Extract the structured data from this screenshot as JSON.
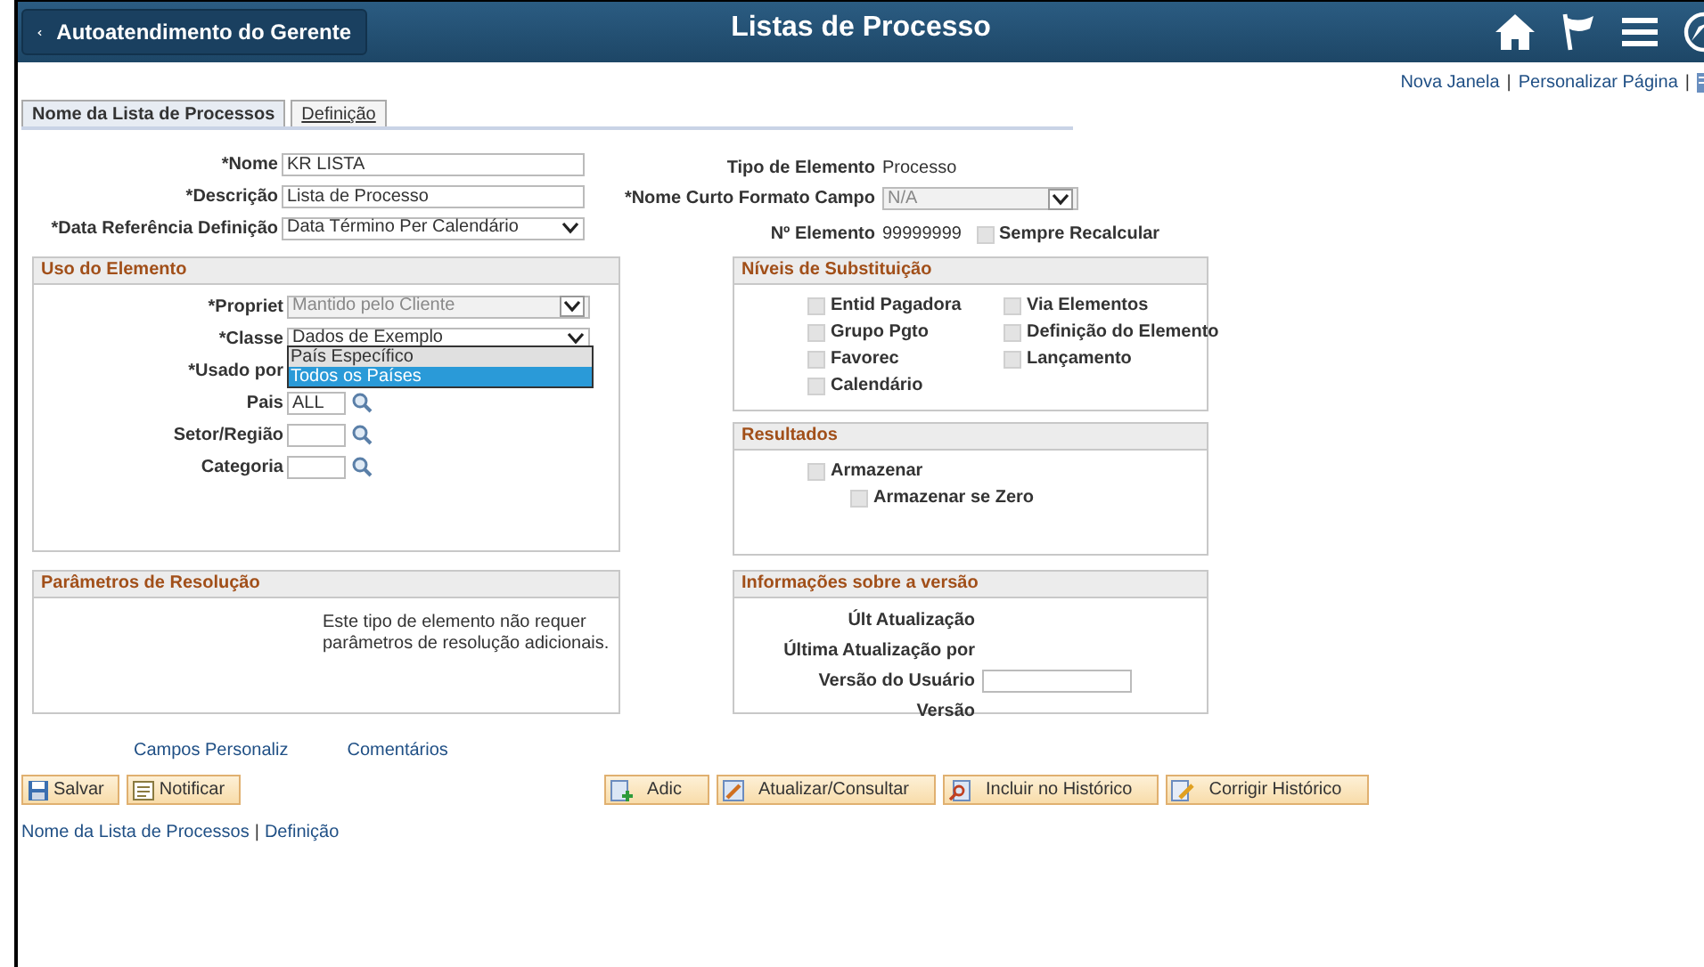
{
  "header": {
    "back_button": "Autoatendimento do Gerente",
    "title": "Listas de Processo"
  },
  "top_links": [
    {
      "kind": "link",
      "text": "Nova Janela"
    },
    {
      "kind": "separator",
      "text": "|"
    },
    {
      "kind": "link",
      "text": "Personalizar Página"
    },
    {
      "kind": "separator",
      "text": "|"
    }
  ],
  "tabs": [
    {
      "label": "Nome da Lista de Processos",
      "selected": true
    },
    {
      "label": "Definição",
      "selected": false
    }
  ],
  "fields_left": [
    {
      "label": "*Nome",
      "value": "KR LISTA",
      "kind": "text"
    },
    {
      "label": "*Descrição",
      "value": "Lista de Processo",
      "kind": "text"
    },
    {
      "label": "*Data Referência Definição",
      "value": "Data Término Per Calendário",
      "kind": "select"
    }
  ],
  "fields_right": [
    {
      "label": "Tipo de Elemento",
      "value": "Processo",
      "kind": "static"
    },
    {
      "label": "*Nome Curto Formato Campo",
      "value": "N/A",
      "kind": "select_disabled"
    },
    {
      "label": "Nº Elemento",
      "value": "99999999",
      "kind": "static",
      "checkbox": {
        "label": "Sempre Recalcular",
        "checked": false,
        "disabled": true
      }
    }
  ],
  "uso_do_elemento": {
    "title": "Uso do Elemento",
    "fields": [
      {
        "label": "*Propriet",
        "value": "Mantido pelo Cliente",
        "kind": "select_disabled"
      },
      {
        "label": "*Classe",
        "value": "Dados de Exemplo",
        "kind": "select",
        "dropdown": [
          {
            "label": "País Específico",
            "selected": false
          },
          {
            "label": "Todos os Países",
            "selected": true
          }
        ]
      },
      {
        "label": "*Usado por"
      },
      {
        "label": "Pais",
        "value": "ALL",
        "kind": "prompt"
      },
      {
        "label": "Setor/Região",
        "kind": "prompt"
      },
      {
        "label": "Categoria",
        "kind": "prompt"
      }
    ]
  },
  "niveis_de_substituicao": {
    "title": "Níveis de Substituição",
    "checkboxes": [
      {
        "label": "Entid Pagadora",
        "checked": false,
        "disabled": true
      },
      {
        "label": "Via Elementos",
        "checked": false,
        "disabled": true
      },
      {
        "label": "Grupo Pgto",
        "checked": false,
        "disabled": true
      },
      {
        "label": "Definição do Elemento",
        "checked": false,
        "disabled": true
      },
      {
        "label": "Favorec",
        "checked": false,
        "disabled": true
      },
      {
        "label": "Lançamento",
        "checked": false,
        "disabled": true
      },
      {
        "label": "Calendário",
        "checked": false,
        "disabled": true
      }
    ]
  },
  "resultados": {
    "title": "Resultados",
    "checkboxes": [
      {
        "label": "Armazenar",
        "checked": false,
        "disabled": true,
        "children": [
          {
            "label": "Armazenar se Zero",
            "checked": false,
            "disabled": true
          }
        ]
      }
    ]
  },
  "parametros_de_resolucao": {
    "title": "Parâmetros de Resolução",
    "text": "Este tipo de elemento não requer parâmetros de resolução adicionais."
  },
  "informacoes_sobre_a_versao": {
    "title": "Informações sobre a versão",
    "fields": [
      {
        "label": "Últ Atualização",
        "kind": "static"
      },
      {
        "label": "Última Atualização por",
        "kind": "static"
      },
      {
        "label": "Versão do Usuário",
        "kind": "text"
      },
      {
        "label": "Versão",
        "kind": "static"
      }
    ]
  },
  "page_links": [
    "Campos Personaliz",
    "Comentários"
  ],
  "buttons_left": [
    "Salvar",
    "Notificar"
  ],
  "buttons_right": [
    "Adic",
    "Atualizar/Consultar",
    "Incluir no Histórico",
    "Corrigir Histórico"
  ],
  "footer_links": [
    {
      "kind": "link",
      "text": "Nome da Lista de Processos"
    },
    {
      "kind": "separator",
      "text": "|"
    },
    {
      "kind": "link",
      "text": "Definição"
    }
  ]
}
